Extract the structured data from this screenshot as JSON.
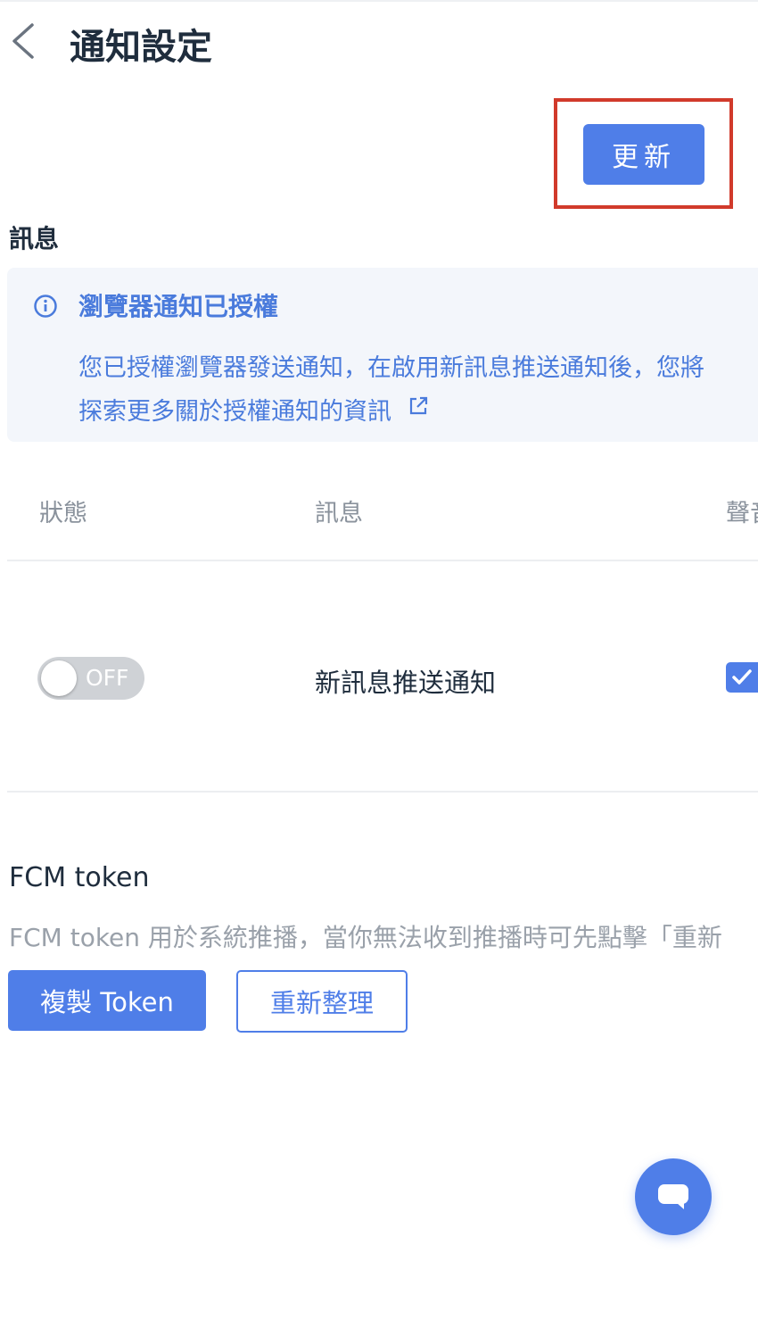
{
  "header": {
    "title": "通知設定"
  },
  "actions": {
    "update_label": "更新"
  },
  "messages_section": {
    "title": "訊息",
    "info": {
      "title": "瀏覽器通知已授權",
      "text": "您已授權瀏覽器發送通知，在啟用新訊息推送通知後，您將",
      "link": "探索更多關於授權通知的資訊"
    },
    "table": {
      "headers": [
        "狀態",
        "訊息",
        "聲音"
      ],
      "rows": [
        {
          "toggle_state": "OFF",
          "label": "新訊息推送通知",
          "sound_checked": true
        }
      ]
    }
  },
  "fcm": {
    "title": "FCM token",
    "description": "FCM token 用於系統推播，當你無法收到推播時可先點擊「重新",
    "copy_label": "複製 Token",
    "refresh_label": "重新整理"
  },
  "colors": {
    "primary": "#4f7ee8",
    "highlight": "#d13a2b",
    "info_bg": "#f3f6fb"
  }
}
